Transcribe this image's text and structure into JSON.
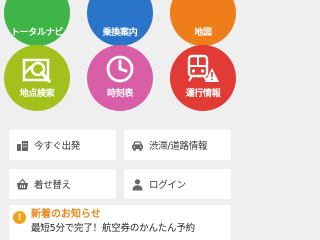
{
  "menu": {
    "total_navi": "トータルナビ",
    "transfer": "乗換案内",
    "map": "地図",
    "spot_search": "地点検索",
    "timetable": "時刻表",
    "service_info": "運行情報"
  },
  "buttons": {
    "depart_now": "今すぐ出発",
    "traffic": "渋滞/道路情報",
    "theme": "着せ替え",
    "login": "ログイン"
  },
  "news": {
    "heading": "新着のお知らせ",
    "body": "最短5分で完了！航空券のかんたん予約"
  },
  "colors": {
    "total_navi": "#3fb548",
    "transfer": "#2a74c9",
    "map": "#ef7d1a",
    "spot_search": "#a3c11d",
    "timetable": "#d85ea7",
    "service_info": "#e23a35",
    "news_heading": "#e9881b",
    "alert": "#f3a11b"
  },
  "icons": {
    "total_navi": "route-icon",
    "transfer": "train-transfer-icon",
    "map": "map-icon",
    "spot_search": "spot-search-icon",
    "timetable": "clock-icon",
    "service_info": "train-alert-icon",
    "depart_now": "building-icon",
    "traffic": "car-icon",
    "theme": "basket-icon",
    "login": "person-icon",
    "news": "alert-icon"
  }
}
